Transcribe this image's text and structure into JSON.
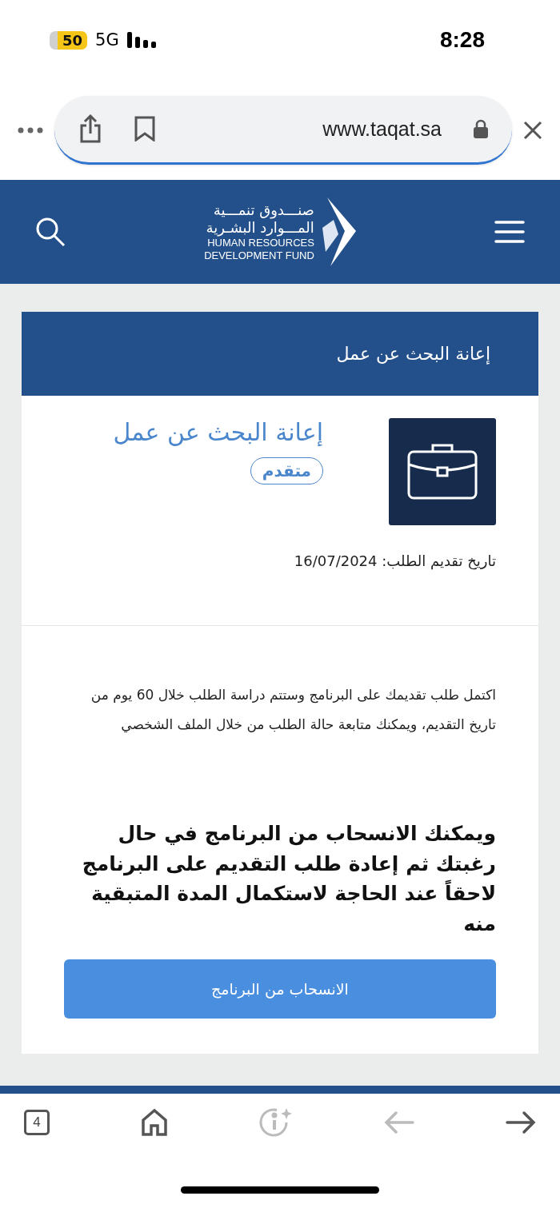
{
  "status_bar": {
    "battery": "50",
    "network": "5G",
    "time": "8:28"
  },
  "browser": {
    "url": "www.taqat.sa",
    "tabs_count": "4"
  },
  "site_header": {
    "logo_lines": [
      "صنـــدوق تنمـــية",
      "المـــوارد البشـرية",
      "HUMAN RESOURCES",
      "DEVELOPMENT FUND"
    ]
  },
  "card": {
    "section_title": "إعانة البحث عن عمل",
    "program_title": "إعانة البحث عن عمل",
    "status_badge": "متقدم",
    "application_date": "تاريخ تقديم الطلب: 16/07/2024",
    "message": "اكتمل طلب تقديمك على البرنامج وستتم دراسة الطلب خلال 60 يوم من تاريخ التقديم، ويمكنك متابعة حالة الطلب من خلال الملف الشخصي",
    "withdraw_note": "ويمكنك الانسحاب من البرنامج في حال رغبتك ثم إعادة طلب التقديم على البرنامج لاحقاً عند الحاجة لاستكمال المدة المتبقية منه",
    "withdraw_button": "الانسحاب من البرنامج"
  }
}
